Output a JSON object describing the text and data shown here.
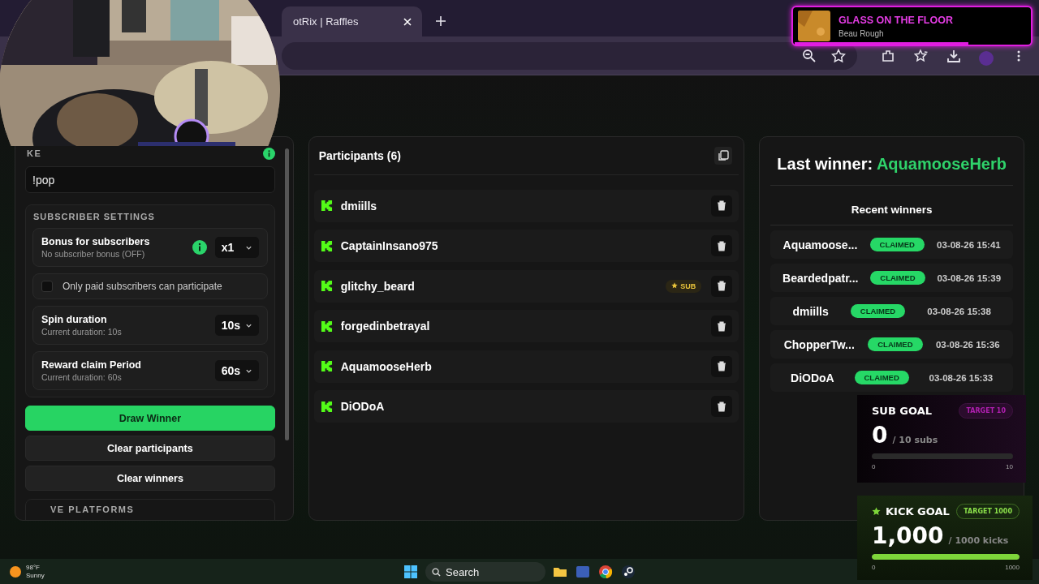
{
  "browser": {
    "tab": {
      "title": "otRix | Raffles"
    }
  },
  "now_playing": {
    "title": "GLASS ON THE FLOOR",
    "artist": "Beau Rough",
    "level": 0.74
  },
  "settings": {
    "keyword_label": "KE",
    "keyword": "!pop",
    "subscriber_title": "SUBSCRIBER SETTINGS",
    "rows": [
      {
        "kind": "select",
        "title": "Bonus for subscribers",
        "subtitle": "No subscriber bonus (OFF)",
        "info": true,
        "value": "x1"
      },
      {
        "kind": "checkbox",
        "label": "Only paid subscribers can participate",
        "checked": false
      },
      {
        "kind": "select",
        "title": "Spin duration",
        "subtitle": "Current duration: 10s",
        "info": false,
        "value": "10s"
      },
      {
        "kind": "select",
        "title": "Reward claim Period",
        "subtitle": "Current duration: 60s",
        "info": false,
        "value": "60s"
      }
    ],
    "buttons": [
      {
        "label": "Draw Winner",
        "primary": true
      },
      {
        "label": "Clear participants",
        "primary": false
      },
      {
        "label": "Clear winners",
        "primary": false
      }
    ],
    "next_section": "VE PLATFORMS"
  },
  "participants": {
    "title": "Participants (6)",
    "items": [
      {
        "name": "dmiills"
      },
      {
        "name": "CaptainInsano975"
      },
      {
        "name": "glitchy_beard",
        "badge": "SUB"
      },
      {
        "name": "forgedinbetrayal"
      },
      {
        "name": "AquamooseHerb"
      },
      {
        "name": "DiODoA"
      }
    ]
  },
  "winners": {
    "label": "Last winner:",
    "name": "AquamooseHerb",
    "recent_title": "Recent winners",
    "items": [
      {
        "name": "Aquamoose...",
        "status": "CLAIMED",
        "time": "03-08-26 15:41"
      },
      {
        "name": "Beardedpatr...",
        "status": "CLAIMED",
        "time": "03-08-26 15:39"
      },
      {
        "name": "dmiills",
        "status": "CLAIMED",
        "time": "03-08-26 15:38"
      },
      {
        "name": "ChopperTw...",
        "status": "CLAIMED",
        "time": "03-08-26 15:36"
      },
      {
        "name": "DiODoA",
        "status": "CLAIMED",
        "time": "03-08-26 15:33"
      }
    ]
  },
  "goals": [
    {
      "kind": "sub",
      "title": "SUB GOAL",
      "target": "TARGET 10",
      "count": "0",
      "unit": "/ 10 subs",
      "level": 0,
      "min": "0",
      "max": "10"
    },
    {
      "kind": "kick",
      "title": "KICK GOAL",
      "target": "TARGET 1000",
      "count": "1,000",
      "unit": "/ 1000 kicks",
      "level": 1,
      "min": "0",
      "max": "1000"
    }
  ],
  "taskbar": {
    "weather": {
      "temp": "98°F",
      "condition": "Sunny"
    },
    "search": "Search"
  }
}
